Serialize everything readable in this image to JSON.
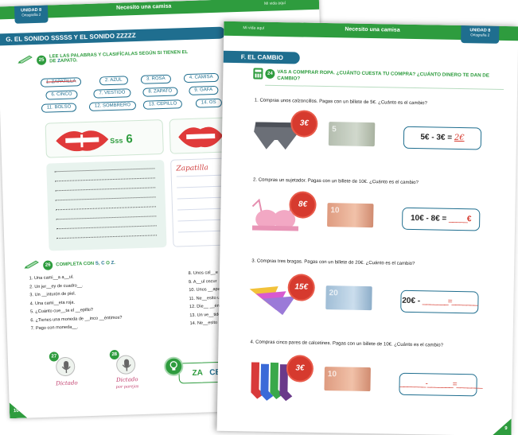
{
  "back_page": {
    "unit_label": "UNIDAD 8",
    "unit_sub": "Ortografía 2",
    "header_title": "Necesito una camisa",
    "header_right": "Mi vida aquí",
    "section_title": "G. EL SONIDO SSSSS Y EL SONIDO ZZZZZ",
    "ex25_number": "25",
    "ex25_instruction_a": "LEE LAS PALABRAS Y CLASIFÍCALAS SEGÚN SI TIENEN EL",
    "ex25_instruction_b_z": "Z",
    "ex25_instruction_b_rest": "APATO.",
    "ex25_instruction_b_prefix": "DE ",
    "words": [
      "1. ZAPATILLA",
      "2. AZUL",
      "3. ROSA",
      "4. CAMISA",
      "6. CINCO",
      "7. VESTIDO",
      "8. ZAPATO",
      "9. GAFA",
      "11. BOLSO",
      "12. SOMBRERO",
      "13. CEPILLO",
      "14. OS"
    ],
    "s_label": "S",
    "s_suffix": "ss",
    "s_count": "6",
    "script_answer": "Zapatilla",
    "ex26_number": "26",
    "ex26_instruction": "COMPLETA CON",
    "ex26_letters": [
      "S",
      "C",
      "O",
      "Z"
    ],
    "ex26_items_left": [
      "1.   Una cami__a a__ul.",
      "2.   Un jer__ey de cuadro__.",
      "3.   Un __inturón de piel.",
      "4.   Una cami__eta roja.",
      "5.   ¿Cuánto cue__ta el __epillo?",
      "6.   ¿Tienes una moneda de __inco __éntimos?",
      "7.   Pago con moneda__."
    ],
    "ex26_items_right": [
      "8.   Unos cal__e",
      "9.   A__ul oscur",
      "10. Unos __apat",
      "11. Ne__esito u",
      "12. Die__ __énti",
      "13. Un ve__tido",
      "14. Ne__esito u"
    ],
    "ex27_number": "27",
    "ex28_number": "28",
    "dictado_1": "Dictado",
    "dictado_2": "Dictado",
    "dictado_2_sub": "por parejas",
    "zace_za": "ZA",
    "zace_ce": "CE",
    "page_number": "10"
  },
  "front_page": {
    "header_left": "Mi vida aquí",
    "header_title": "Necesito una camisa",
    "unit_label": "UNIDAD 8",
    "unit_sub": "Ortografía 2",
    "section_title": "F. EL CAMBIO",
    "ex24_number": "24",
    "ex24_instruction": "VAS A COMPRAR ROPA. ¿CUÁNTO CUESTA TU COMPRA? ¿CUÁNTO DINERO TE DAN DE CAMBIO?",
    "questions": [
      {
        "text": "1.   Compras unos calzoncillos. Pagas con un billete de 5€. ¿Cuánto es el cambio?",
        "price": "3€",
        "bill": "5",
        "answer_left": "5€ - 3€ = ",
        "answer_value": "2€",
        "answer_suffix": ""
      },
      {
        "text": "2.   Compras un sujetador. Pagas con un billete de 10€. ¿Cuánto es el cambio?",
        "price": "8€",
        "bill": "10",
        "answer_left": "10€ - 8€ = ",
        "answer_value": "_____",
        "answer_suffix": "€"
      },
      {
        "text": "3.   Compras tres bragas. Pagas con un billete de 20€. ¿Cuánto es el cambio?",
        "price": "15€",
        "bill": "20",
        "answer_left": "20€ - ",
        "answer_value": "_______=_______",
        "answer_suffix": ""
      },
      {
        "text": "4.   Compras cinco pares de calcetines. Pagas con un billete de 10€. ¿Cuánto es el cambio?",
        "price": "3€",
        "bill": "10",
        "answer_left": "",
        "answer_value": "_______-_______=_______",
        "answer_suffix": ""
      }
    ],
    "page_number": "9"
  },
  "colors": {
    "green": "#2e9c3e",
    "blue": "#1f6e8f",
    "red": "#d63a2e"
  }
}
